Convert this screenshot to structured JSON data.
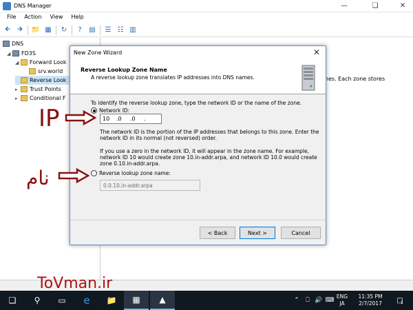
{
  "window": {
    "title": "DNS Manager"
  },
  "menu": [
    "File",
    "Action",
    "View",
    "Help"
  ],
  "tree": {
    "root": "DNS",
    "server": "FD3S",
    "forward": "Forward Look",
    "srv_world": "srv.world",
    "reverse": "Reverse Look",
    "trust": "Trust Points",
    "conditional": "Conditional F"
  },
  "right_pane": {
    "description": "ones. Each zone stores"
  },
  "wizard": {
    "title": "New Zone Wizard",
    "header_title": "Reverse Lookup Zone Name",
    "header_desc": "A reverse lookup zone translates IP addresses into DNS names.",
    "intro": "To identify the reverse lookup zone, type the network ID or the name of the zone.",
    "network_id_label": "Network ID:",
    "ip_octets": [
      "10",
      ".0",
      ".0",
      "."
    ],
    "help1_line1": "The network ID is the portion of the IP addresses that belongs to this zone. Enter the",
    "help1_line2": "network ID in its normal (not reversed) order.",
    "help2_line1": "If you use a zero in the network ID, it will appear in the zone name. For example,",
    "help2_line2": "network ID 10 would create zone 10.in-addr.arpa, and network ID 10.0 would create",
    "help2_line3": "zone 0.10.in-addr.arpa.",
    "zone_name_label": "Reverse lookup zone name:",
    "zone_name_value": "0.0.10.in-addr.arpa",
    "back_button": "< Back",
    "next_button": "Next >",
    "cancel_button": "Cancel"
  },
  "annotations": {
    "ip": "IP",
    "name": "نام",
    "watermark": "ToVman.ir"
  },
  "taskbar": {
    "lang_top": "ENG",
    "lang_bottom": "JA",
    "time": "11:35 PM",
    "date": "2/7/2017",
    "notification_count": "1"
  }
}
